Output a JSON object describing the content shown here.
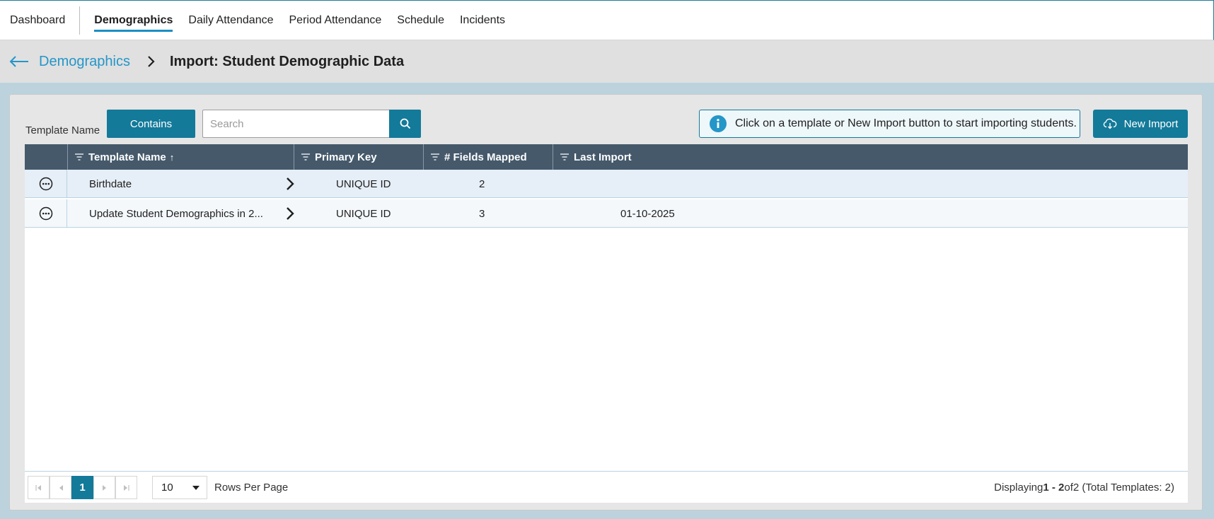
{
  "nav": {
    "items": [
      {
        "label": "Dashboard"
      },
      {
        "label": "Demographics"
      },
      {
        "label": "Daily Attendance"
      },
      {
        "label": "Period Attendance"
      },
      {
        "label": "Schedule"
      },
      {
        "label": "Incidents"
      }
    ],
    "active_index": 1
  },
  "breadcrumb": {
    "parent": "Demographics",
    "current": "Import: Student Demographic Data"
  },
  "toolbar": {
    "filter_label": "Template Name",
    "contains_label": "Contains",
    "search_placeholder": "Search",
    "info_message": "Click on a template or New Import button to start importing students.",
    "new_import_label": "New Import"
  },
  "grid": {
    "columns": [
      {
        "label": "Template Name",
        "sort": "↑"
      },
      {
        "label": "Primary Key"
      },
      {
        "label": "# Fields Mapped"
      },
      {
        "label": "Last Import"
      }
    ],
    "rows": [
      {
        "template_name": "Birthdate",
        "primary_key": "UNIQUE ID",
        "fields_mapped": "2",
        "last_import": ""
      },
      {
        "template_name": "Update Student Demographics in 2...",
        "primary_key": "UNIQUE ID",
        "fields_mapped": "3",
        "last_import": "01-10-2025"
      }
    ]
  },
  "pager": {
    "current_page": "1",
    "rows_per_page": "10",
    "rows_per_page_label": "Rows Per Page",
    "displaying_prefix": "Displaying",
    "range": "1 - 2",
    "of_text": "of",
    "total_text": "2 (Total Templates: 2)"
  },
  "colors": {
    "accent": "#137a9a",
    "header_bg": "#45596b",
    "link": "#2596c8"
  }
}
